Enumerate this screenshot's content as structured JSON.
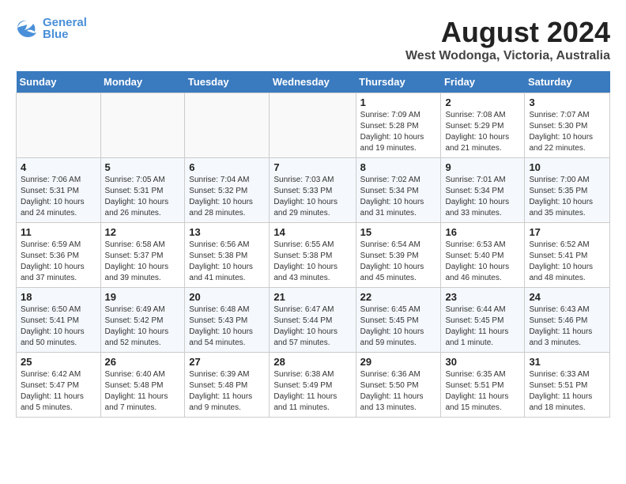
{
  "header": {
    "logo_line1": "General",
    "logo_line2": "Blue",
    "title": "August 2024",
    "subtitle": "West Wodonga, Victoria, Australia"
  },
  "days_of_week": [
    "Sunday",
    "Monday",
    "Tuesday",
    "Wednesday",
    "Thursday",
    "Friday",
    "Saturday"
  ],
  "weeks": [
    [
      {
        "num": "",
        "info": ""
      },
      {
        "num": "",
        "info": ""
      },
      {
        "num": "",
        "info": ""
      },
      {
        "num": "",
        "info": ""
      },
      {
        "num": "1",
        "info": "Sunrise: 7:09 AM\nSunset: 5:28 PM\nDaylight: 10 hours\nand 19 minutes."
      },
      {
        "num": "2",
        "info": "Sunrise: 7:08 AM\nSunset: 5:29 PM\nDaylight: 10 hours\nand 21 minutes."
      },
      {
        "num": "3",
        "info": "Sunrise: 7:07 AM\nSunset: 5:30 PM\nDaylight: 10 hours\nand 22 minutes."
      }
    ],
    [
      {
        "num": "4",
        "info": "Sunrise: 7:06 AM\nSunset: 5:31 PM\nDaylight: 10 hours\nand 24 minutes."
      },
      {
        "num": "5",
        "info": "Sunrise: 7:05 AM\nSunset: 5:31 PM\nDaylight: 10 hours\nand 26 minutes."
      },
      {
        "num": "6",
        "info": "Sunrise: 7:04 AM\nSunset: 5:32 PM\nDaylight: 10 hours\nand 28 minutes."
      },
      {
        "num": "7",
        "info": "Sunrise: 7:03 AM\nSunset: 5:33 PM\nDaylight: 10 hours\nand 29 minutes."
      },
      {
        "num": "8",
        "info": "Sunrise: 7:02 AM\nSunset: 5:34 PM\nDaylight: 10 hours\nand 31 minutes."
      },
      {
        "num": "9",
        "info": "Sunrise: 7:01 AM\nSunset: 5:34 PM\nDaylight: 10 hours\nand 33 minutes."
      },
      {
        "num": "10",
        "info": "Sunrise: 7:00 AM\nSunset: 5:35 PM\nDaylight: 10 hours\nand 35 minutes."
      }
    ],
    [
      {
        "num": "11",
        "info": "Sunrise: 6:59 AM\nSunset: 5:36 PM\nDaylight: 10 hours\nand 37 minutes."
      },
      {
        "num": "12",
        "info": "Sunrise: 6:58 AM\nSunset: 5:37 PM\nDaylight: 10 hours\nand 39 minutes."
      },
      {
        "num": "13",
        "info": "Sunrise: 6:56 AM\nSunset: 5:38 PM\nDaylight: 10 hours\nand 41 minutes."
      },
      {
        "num": "14",
        "info": "Sunrise: 6:55 AM\nSunset: 5:38 PM\nDaylight: 10 hours\nand 43 minutes."
      },
      {
        "num": "15",
        "info": "Sunrise: 6:54 AM\nSunset: 5:39 PM\nDaylight: 10 hours\nand 45 minutes."
      },
      {
        "num": "16",
        "info": "Sunrise: 6:53 AM\nSunset: 5:40 PM\nDaylight: 10 hours\nand 46 minutes."
      },
      {
        "num": "17",
        "info": "Sunrise: 6:52 AM\nSunset: 5:41 PM\nDaylight: 10 hours\nand 48 minutes."
      }
    ],
    [
      {
        "num": "18",
        "info": "Sunrise: 6:50 AM\nSunset: 5:41 PM\nDaylight: 10 hours\nand 50 minutes."
      },
      {
        "num": "19",
        "info": "Sunrise: 6:49 AM\nSunset: 5:42 PM\nDaylight: 10 hours\nand 52 minutes."
      },
      {
        "num": "20",
        "info": "Sunrise: 6:48 AM\nSunset: 5:43 PM\nDaylight: 10 hours\nand 54 minutes."
      },
      {
        "num": "21",
        "info": "Sunrise: 6:47 AM\nSunset: 5:44 PM\nDaylight: 10 hours\nand 57 minutes."
      },
      {
        "num": "22",
        "info": "Sunrise: 6:45 AM\nSunset: 5:45 PM\nDaylight: 10 hours\nand 59 minutes."
      },
      {
        "num": "23",
        "info": "Sunrise: 6:44 AM\nSunset: 5:45 PM\nDaylight: 11 hours\nand 1 minute."
      },
      {
        "num": "24",
        "info": "Sunrise: 6:43 AM\nSunset: 5:46 PM\nDaylight: 11 hours\nand 3 minutes."
      }
    ],
    [
      {
        "num": "25",
        "info": "Sunrise: 6:42 AM\nSunset: 5:47 PM\nDaylight: 11 hours\nand 5 minutes."
      },
      {
        "num": "26",
        "info": "Sunrise: 6:40 AM\nSunset: 5:48 PM\nDaylight: 11 hours\nand 7 minutes."
      },
      {
        "num": "27",
        "info": "Sunrise: 6:39 AM\nSunset: 5:48 PM\nDaylight: 11 hours\nand 9 minutes."
      },
      {
        "num": "28",
        "info": "Sunrise: 6:38 AM\nSunset: 5:49 PM\nDaylight: 11 hours\nand 11 minutes."
      },
      {
        "num": "29",
        "info": "Sunrise: 6:36 AM\nSunset: 5:50 PM\nDaylight: 11 hours\nand 13 minutes."
      },
      {
        "num": "30",
        "info": "Sunrise: 6:35 AM\nSunset: 5:51 PM\nDaylight: 11 hours\nand 15 minutes."
      },
      {
        "num": "31",
        "info": "Sunrise: 6:33 AM\nSunset: 5:51 PM\nDaylight: 11 hours\nand 18 minutes."
      }
    ]
  ]
}
